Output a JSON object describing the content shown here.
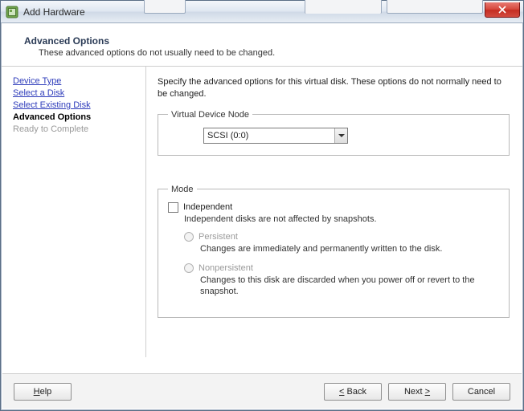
{
  "window": {
    "title": "Add Hardware"
  },
  "header": {
    "title": "Advanced Options",
    "subtitle": "These advanced options do not usually need to be changed."
  },
  "sidebar": {
    "items": [
      {
        "label": "Device Type",
        "state": "link"
      },
      {
        "label": "Select a Disk",
        "state": "link"
      },
      {
        "label": "Select Existing Disk",
        "state": "link"
      },
      {
        "label": "Advanced Options",
        "state": "current"
      },
      {
        "label": "Ready to Complete",
        "state": "disabled"
      }
    ]
  },
  "panel": {
    "description": "Specify the advanced options for this virtual disk. These options do not normally need to be changed.",
    "vdn": {
      "legend": "Virtual Device Node",
      "selected": "SCSI (0:0)"
    },
    "mode": {
      "legend": "Mode",
      "independent_label": "Independent",
      "independent_desc": "Independent disks are not affected by snapshots.",
      "persistent_label": "Persistent",
      "persistent_desc": "Changes are immediately and permanently written to the disk.",
      "nonpersistent_label": "Nonpersistent",
      "nonpersistent_desc": "Changes to this disk are discarded when you power off or revert to the snapshot."
    }
  },
  "footer": {
    "help": "Help",
    "back": "Back",
    "next": "Next",
    "cancel": "Cancel"
  }
}
